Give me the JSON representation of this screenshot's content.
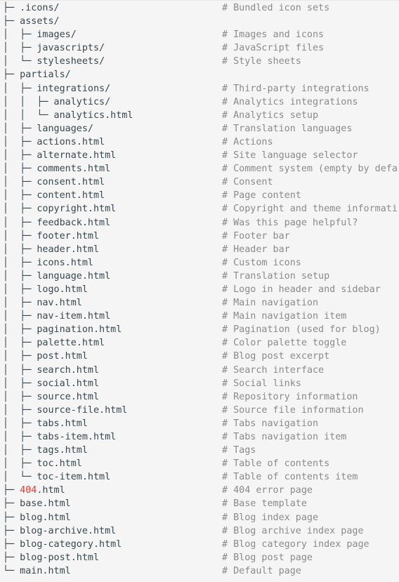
{
  "colors": {
    "background": "#f5f5f5",
    "text": "#37474f",
    "comment": "#8a8a8a",
    "accent": "#e53935"
  },
  "lines": [
    {
      "tree": "├─ .icons/",
      "comment": "# Bundled icon sets"
    },
    {
      "tree": "├─ assets/",
      "comment": ""
    },
    {
      "tree": "│  ├─ images/",
      "comment": "# Images and icons"
    },
    {
      "tree": "│  ├─ javascripts/",
      "comment": "# JavaScript files"
    },
    {
      "tree": "│  └─ stylesheets/",
      "comment": "# Style sheets"
    },
    {
      "tree": "├─ partials/",
      "comment": ""
    },
    {
      "tree": "│  ├─ integrations/",
      "comment": "# Third-party integrations"
    },
    {
      "tree": "│  │  ├─ analytics/",
      "comment": "# Analytics integrations"
    },
    {
      "tree": "│  │  └─ analytics.html",
      "comment": "# Analytics setup"
    },
    {
      "tree": "│  ├─ languages/",
      "comment": "# Translation languages"
    },
    {
      "tree": "│  ├─ actions.html",
      "comment": "# Actions"
    },
    {
      "tree": "│  ├─ alternate.html",
      "comment": "# Site language selector"
    },
    {
      "tree": "│  ├─ comments.html",
      "comment": "# Comment system (empty by defa"
    },
    {
      "tree": "│  ├─ consent.html",
      "comment": "# Consent"
    },
    {
      "tree": "│  ├─ content.html",
      "comment": "# Page content"
    },
    {
      "tree": "│  ├─ copyright.html",
      "comment": "# Copyright and theme informati"
    },
    {
      "tree": "│  ├─ feedback.html",
      "comment": "# Was this page helpful?"
    },
    {
      "tree": "│  ├─ footer.html",
      "comment": "# Footer bar"
    },
    {
      "tree": "│  ├─ header.html",
      "comment": "# Header bar"
    },
    {
      "tree": "│  ├─ icons.html",
      "comment": "# Custom icons"
    },
    {
      "tree": "│  ├─ language.html",
      "comment": "# Translation setup"
    },
    {
      "tree": "│  ├─ logo.html",
      "comment": "# Logo in header and sidebar"
    },
    {
      "tree": "│  ├─ nav.html",
      "comment": "# Main navigation"
    },
    {
      "tree": "│  ├─ nav-item.html",
      "comment": "# Main navigation item"
    },
    {
      "tree": "│  ├─ pagination.html",
      "comment": "# Pagination (used for blog)"
    },
    {
      "tree": "│  ├─ palette.html",
      "comment": "# Color palette toggle"
    },
    {
      "tree": "│  ├─ post.html",
      "comment": "# Blog post excerpt"
    },
    {
      "tree": "│  ├─ search.html",
      "comment": "# Search interface"
    },
    {
      "tree": "│  ├─ social.html",
      "comment": "# Social links"
    },
    {
      "tree": "│  ├─ source.html",
      "comment": "# Repository information"
    },
    {
      "tree": "│  ├─ source-file.html",
      "comment": "# Source file information"
    },
    {
      "tree": "│  ├─ tabs.html",
      "comment": "# Tabs navigation"
    },
    {
      "tree": "│  ├─ tabs-item.html",
      "comment": "# Tabs navigation item"
    },
    {
      "tree": "│  ├─ tags.html",
      "comment": "# Tags"
    },
    {
      "tree": "│  ├─ toc.html",
      "comment": "# Table of contents"
    },
    {
      "tree": "│  └─ toc-item.html",
      "comment": "# Table of contents item"
    },
    {
      "tree": "├─ ",
      "accent": "404",
      "tree_suffix": ".html",
      "comment": "# 404 error page"
    },
    {
      "tree": "├─ base.html",
      "comment": "# Base template"
    },
    {
      "tree": "├─ blog.html",
      "comment": "# Blog index page"
    },
    {
      "tree": "├─ blog-archive.html",
      "comment": "# Blog archive index page"
    },
    {
      "tree": "├─ blog-category.html",
      "comment": "# Blog category index page"
    },
    {
      "tree": "├─ blog-post.html",
      "comment": "# Blog post page"
    },
    {
      "tree": "└─ main.html",
      "comment": "# Default page"
    }
  ]
}
